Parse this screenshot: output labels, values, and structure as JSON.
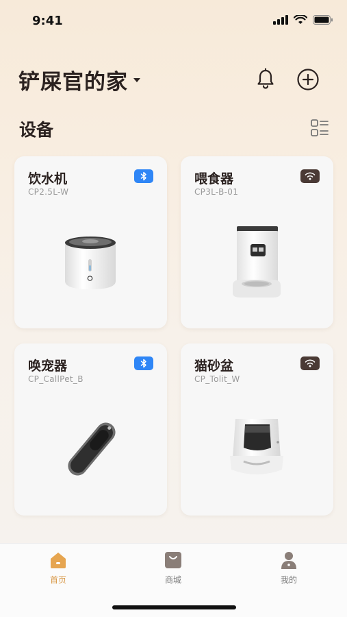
{
  "status_bar": {
    "time": "9:41"
  },
  "header": {
    "home_name": "铲屎官的家"
  },
  "section": {
    "title": "设备"
  },
  "devices": [
    {
      "name": "饮水机",
      "model": "CP2.5L-W",
      "connection": "bluetooth-icon"
    },
    {
      "name": "喂食器",
      "model": "CP3L-B-01",
      "connection": "wifi-icon"
    },
    {
      "name": "唤宠器",
      "model": "CP_CallPet_B",
      "connection": "bluetooth-icon"
    },
    {
      "name": "猫砂盆",
      "model": "CP_Tolit_W",
      "connection": "wifi-icon"
    }
  ],
  "tabs": [
    {
      "label": "首页",
      "icon": "home-icon",
      "active": true
    },
    {
      "label": "商城",
      "icon": "shop-bag-icon",
      "active": false
    },
    {
      "label": "我的",
      "icon": "profile-icon",
      "active": false
    }
  ],
  "colors": {
    "accent": "#d99a4a",
    "bluetooth": "#2f86f6",
    "wifi_badge": "#4a3a35"
  }
}
